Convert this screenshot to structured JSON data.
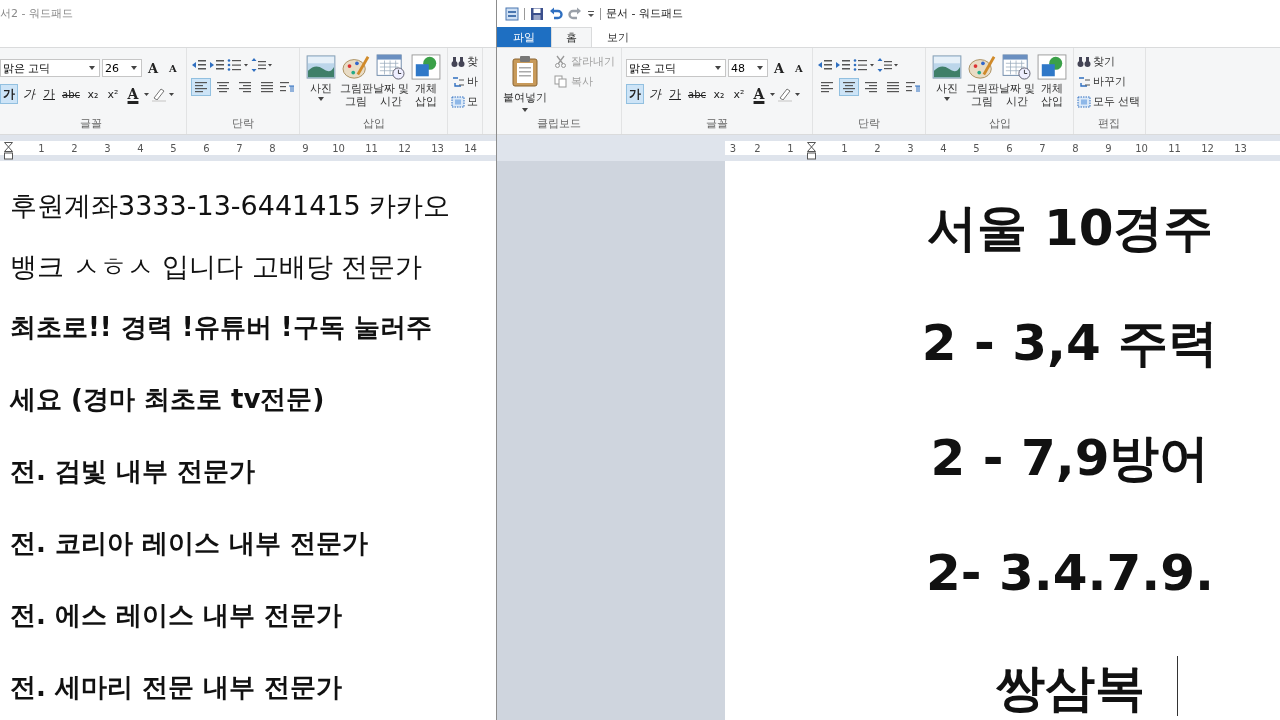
{
  "windows": [
    {
      "title": "서2 - 워드패드",
      "ribbon": {
        "groups": [
          {
            "kind": "font",
            "label": "글꼴",
            "family": "맑은 고딕",
            "size": "26",
            "grow": "A",
            "shrink": "A",
            "font_color": "A",
            "format": [
              {
                "kind": "bold",
                "label": "가",
                "selected": true
              },
              {
                "kind": "italic",
                "label": "가",
                "selected": false
              },
              {
                "kind": "underline",
                "label": "가",
                "selected": false
              },
              {
                "kind": "strike",
                "label": "abc",
                "selected": false
              },
              {
                "kind": "subscript",
                "label": "x₂",
                "selected": false
              },
              {
                "kind": "superscript",
                "label": "x²",
                "selected": false
              }
            ]
          },
          {
            "kind": "paragraph",
            "label": "단락",
            "alignment": [
              {
                "kind": "left",
                "selected": true
              },
              {
                "kind": "center",
                "selected": false
              },
              {
                "kind": "right",
                "selected": false
              },
              {
                "kind": "justify",
                "selected": false
              }
            ]
          },
          {
            "kind": "insert",
            "label": "삽입",
            "items": [
              {
                "kind": "picture",
                "label": [
                  "사진"
                ],
                "dropdown": true
              },
              {
                "kind": "paint",
                "label": [
                  "그림판",
                  "그림"
                ]
              },
              {
                "kind": "datetime",
                "label": [
                  "날짜 및",
                  "시간"
                ]
              },
              {
                "kind": "object",
                "label": [
                  "개체",
                  "삽입"
                ]
              }
            ]
          },
          {
            "kind": "editing",
            "items": [
              {
                "kind": "find",
                "label": "찾"
              },
              {
                "kind": "replace",
                "label": "바"
              },
              {
                "kind": "select_all",
                "label": "모"
              }
            ]
          }
        ]
      },
      "ruler": {
        "after": [
          "1",
          "2",
          "3",
          "4",
          "5",
          "6",
          "7",
          "8",
          "9",
          "10",
          "11",
          "12",
          "13",
          "14"
        ]
      },
      "document": {
        "lines": [
          {
            "text": "후원계좌3333-13-6441415 카카오",
            "bold": false
          },
          {
            "text": "뱅크 ㅅㅎㅅ 입니다  고배당 전문가",
            "bold": false
          },
          {
            "text": "최초로!! 경력 !유튜버 !구독 눌러주",
            "bold": true
          },
          {
            "text": "세요 (경마 최초로 tv전문)",
            "bold": true
          },
          {
            "text": "전. 검빛 내부 전문가",
            "bold": true
          },
          {
            "text": "전. 코리아 레이스 내부 전문가",
            "bold": true
          },
          {
            "text": "전. 에스 레이스 내부 전문가",
            "bold": true
          },
          {
            "text": "전. 세마리 전문 내부 전문가",
            "bold": true
          }
        ]
      }
    },
    {
      "title": "문서 - 워드패드",
      "quick_access": true,
      "tabs": [
        {
          "kind": "file",
          "label": "파일",
          "selected": false
        },
        {
          "kind": "tab",
          "label": "홈",
          "selected": true
        },
        {
          "kind": "tab",
          "label": "보기",
          "selected": false
        }
      ],
      "ribbon": {
        "groups": [
          {
            "kind": "clipboard",
            "label": "클립보드",
            "paste": "붙여넣기",
            "items": [
              {
                "kind": "cut",
                "label": "잘라내기",
                "disabled": true
              },
              {
                "kind": "copy",
                "label": "복사",
                "disabled": true
              }
            ]
          },
          {
            "kind": "font",
            "label": "글꼴",
            "family": "맑은 고딕",
            "size": "48",
            "grow": "A",
            "shrink": "A",
            "font_color": "A",
            "format": [
              {
                "kind": "bold",
                "label": "가",
                "selected": true
              },
              {
                "kind": "italic",
                "label": "가",
                "selected": false
              },
              {
                "kind": "underline",
                "label": "가",
                "selected": false
              },
              {
                "kind": "strike",
                "label": "abc",
                "selected": false
              },
              {
                "kind": "subscript",
                "label": "x₂",
                "selected": false
              },
              {
                "kind": "superscript",
                "label": "x²",
                "selected": false
              }
            ]
          },
          {
            "kind": "paragraph",
            "label": "단락",
            "alignment": [
              {
                "kind": "left",
                "selected": false
              },
              {
                "kind": "center",
                "selected": true
              },
              {
                "kind": "right",
                "selected": false
              },
              {
                "kind": "justify",
                "selected": false
              }
            ]
          },
          {
            "kind": "insert",
            "label": "삽입",
            "items": [
              {
                "kind": "picture",
                "label": [
                  "사진"
                ],
                "dropdown": true
              },
              {
                "kind": "paint",
                "label": [
                  "그림판",
                  "그림"
                ]
              },
              {
                "kind": "datetime",
                "label": [
                  "날짜 및",
                  "시간"
                ]
              },
              {
                "kind": "object",
                "label": [
                  "개체",
                  "삽입"
                ]
              }
            ]
          },
          {
            "kind": "editing",
            "label": "편집",
            "items": [
              {
                "kind": "find",
                "label": "찾기"
              },
              {
                "kind": "replace",
                "label": "바꾸기"
              },
              {
                "kind": "select_all",
                "label": "모두 선택"
              }
            ]
          }
        ]
      },
      "ruler": {
        "before": [
          "3",
          "2",
          "1"
        ],
        "after": [
          "1",
          "2",
          "3",
          "4",
          "5",
          "6",
          "7",
          "8",
          "9",
          "10",
          "11",
          "12",
          "13"
        ]
      },
      "document": {
        "caret": true,
        "lines": [
          {
            "text": "서울 10경주",
            "bold": true
          },
          {
            "text": "2 - 3,4 주력",
            "bold": true
          },
          {
            "text": "2 - 7,9방어",
            "bold": true
          },
          {
            "text": "2- 3.4.7.9.",
            "bold": true
          },
          {
            "text": "쌍삼복",
            "bold": true
          }
        ]
      }
    }
  ]
}
